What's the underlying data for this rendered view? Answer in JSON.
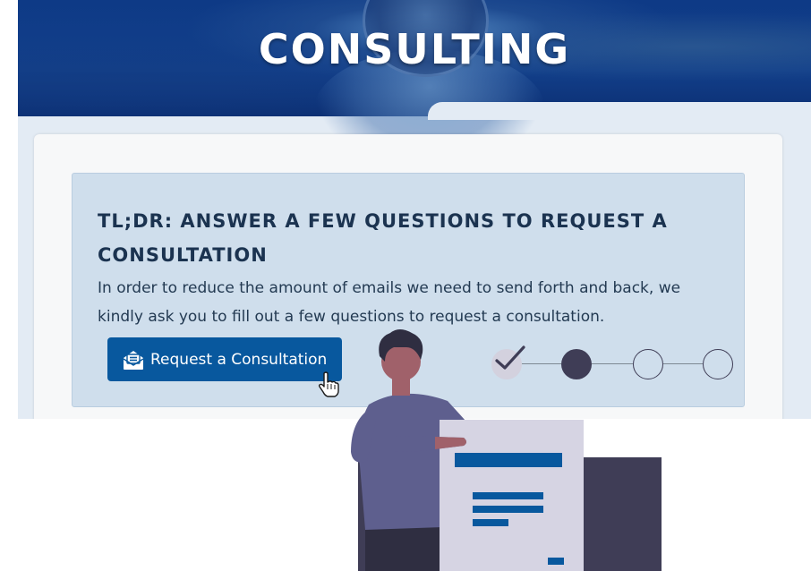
{
  "hero": {
    "title": "CONSULTING"
  },
  "intro": {
    "heading": "TL;DR: ANSWER A FEW QUESTIONS TO REQUEST A CONSULTATION",
    "body": "In order to reduce the amount of emails we need to send forth and back, we kindly ask you to fill out a few questions to request a consultation."
  },
  "request_button": {
    "label": "Request a Consultation",
    "icon": "open-envelope-icon"
  },
  "stepper": {
    "steps": [
      {
        "state": "completed",
        "icon": "check-icon"
      },
      {
        "state": "current"
      },
      {
        "state": "upcoming"
      },
      {
        "state": "upcoming"
      }
    ]
  },
  "colors": {
    "hero_blue": "#0e3a86",
    "button_blue": "#08589e",
    "panel_bg": "#cfdeec",
    "page_bg": "#e3ebf4",
    "heading_text": "#1b3350",
    "step_current": "#3f3d56",
    "step_done": "#d3d1de",
    "person_shirt": "#5e5f8e",
    "form_card": "#d6d4e3"
  }
}
